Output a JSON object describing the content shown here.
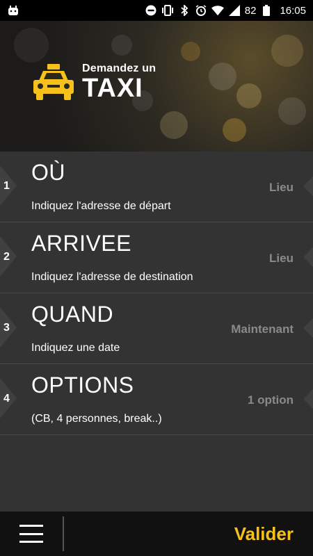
{
  "status_bar": {
    "battery": "82",
    "time": "16:05",
    "icons": [
      "android-icon",
      "do-not-disturb-icon",
      "vibrate-icon",
      "bluetooth-icon",
      "alarm-icon",
      "wifi-icon",
      "signal-icon",
      "battery-icon"
    ]
  },
  "header": {
    "subtitle": "Demandez un",
    "title": "TAXI",
    "icon": "taxi-icon",
    "accent_color": "#f5c11a"
  },
  "rows": [
    {
      "num": "1",
      "title": "OÙ",
      "subtitle": "Indiquez l'adresse de départ",
      "value": "Lieu"
    },
    {
      "num": "2",
      "title": "ARRIVEE",
      "subtitle": "Indiquez l'adresse de destination",
      "value": "Lieu"
    },
    {
      "num": "3",
      "title": "QUAND",
      "subtitle": "Indiquez une date",
      "value": "Maintenant"
    },
    {
      "num": "4",
      "title": "OPTIONS",
      "subtitle": "(CB, 4 personnes, break..)",
      "value": "1 option"
    }
  ],
  "bottom_bar": {
    "menu_icon": "hamburger-menu-icon",
    "confirm_label": "Valider"
  }
}
